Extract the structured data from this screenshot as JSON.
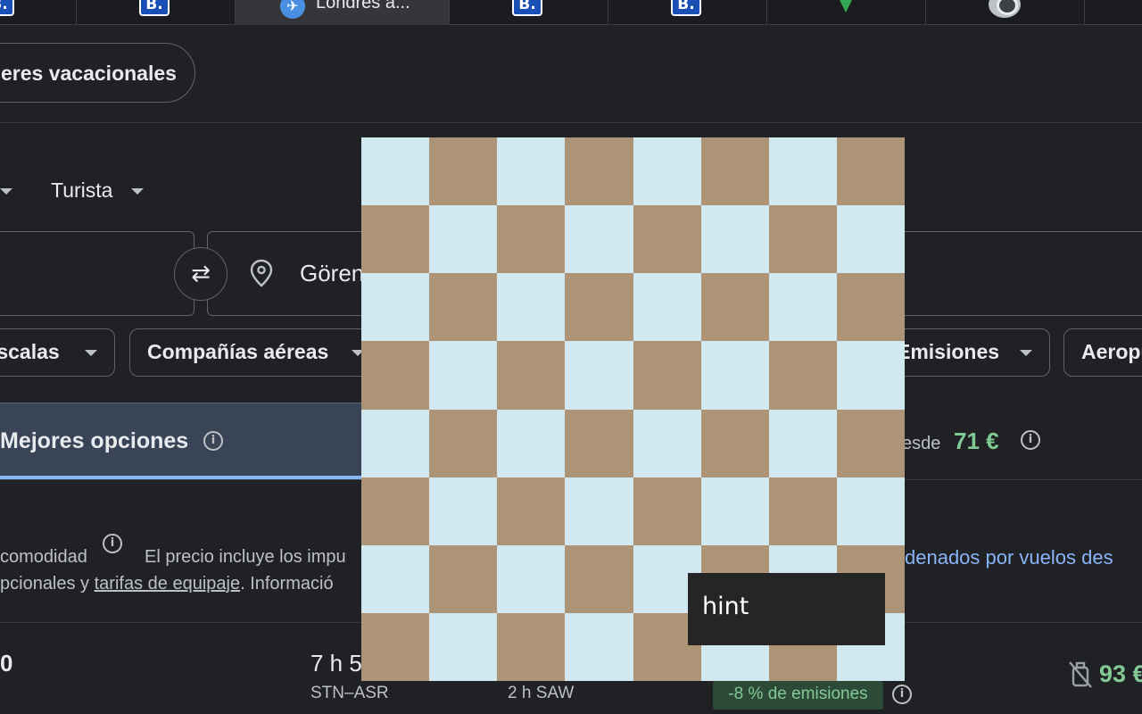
{
  "tabs": {
    "active_title": "Londres a...",
    "favicon_letter": "B."
  },
  "header": {
    "chip_label": "eres vacacionales"
  },
  "search": {
    "class_label": "Turista",
    "destination": "Gören",
    "swap_symbol": "⇄"
  },
  "filters": {
    "stops": "Escalas",
    "airlines": "Compañías aéreas",
    "emissions": "Emisiones",
    "airports": "Aeropu"
  },
  "sort_tabs": {
    "best": "Mejores opciones",
    "desde_label": "esde",
    "desde_price": "71 €"
  },
  "info": {
    "comodidad": "comodidad",
    "precio": "El precio incluye los impu",
    "link": "denados por vuelos des",
    "line2_a": "pcionales y ",
    "line2_link": "tarifas de equipaje",
    "line2_b": ". Informació"
  },
  "flight_row": {
    "time_partial": "0",
    "duration": "7 h 5",
    "route": "STN–ASR",
    "layover": "2 h SAW",
    "emissions_badge": "-8 % de emisiones",
    "price": "93 €"
  },
  "overlay": {
    "hint_label": "hint",
    "board_pattern": "checkerboard-8x8"
  },
  "colors": {
    "light_square": "#d1e8f0",
    "dark_square": "#ad9477",
    "price_green": "#81c995",
    "link_blue": "#8ab4f8"
  }
}
